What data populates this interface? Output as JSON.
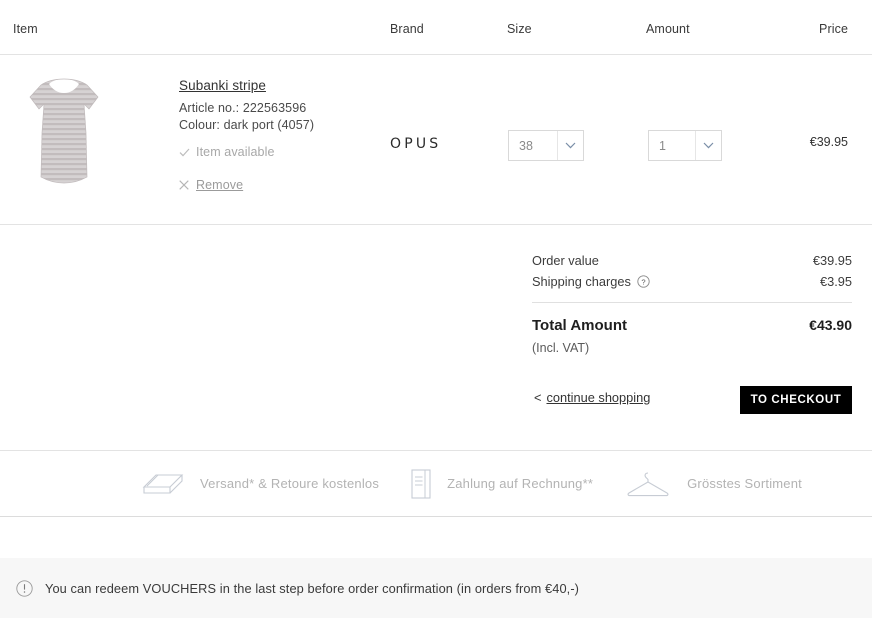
{
  "cart_header": {
    "item": "Item",
    "brand": "Brand",
    "size": "Size",
    "amount": "Amount",
    "price": "Price"
  },
  "product": {
    "title": "Subanki stripe",
    "article_label": "Article no.: 222563596",
    "colour_label": "Colour: dark port (4057)",
    "availability": "Item available",
    "remove": "Remove",
    "brand": "OPUS",
    "size_value": "38",
    "amount_value": "1",
    "price": "€39.95",
    "image_alt": "striped long sleeve top"
  },
  "summary": {
    "order_value_label": "Order value",
    "order_value": "€39.95",
    "shipping_label": "Shipping charges",
    "shipping_value": "€3.95",
    "total_label": "Total Amount",
    "total_value": "€43.90",
    "vat_note": "(Incl. VAT)"
  },
  "actions": {
    "continue_shopping": "continue shopping",
    "continue_chevron": "<",
    "checkout": "TO CHECKOUT"
  },
  "services": [
    {
      "icon": "box-icon",
      "label": "Versand* & Retoure kostenlos"
    },
    {
      "icon": "invoice-icon",
      "label": "Zahlung auf Rechnung**"
    },
    {
      "icon": "hanger-icon",
      "label": "Grösstes Sortiment"
    }
  ],
  "voucher": {
    "icon": "info-icon",
    "text": "You can redeem VOUCHERS in the last step before order confirmation (in orders from €40,-)"
  },
  "colors": {
    "accent": "#000000",
    "border": "#e3e3e3",
    "muted": "#b3b3b3",
    "band": "#f7f7f7"
  }
}
